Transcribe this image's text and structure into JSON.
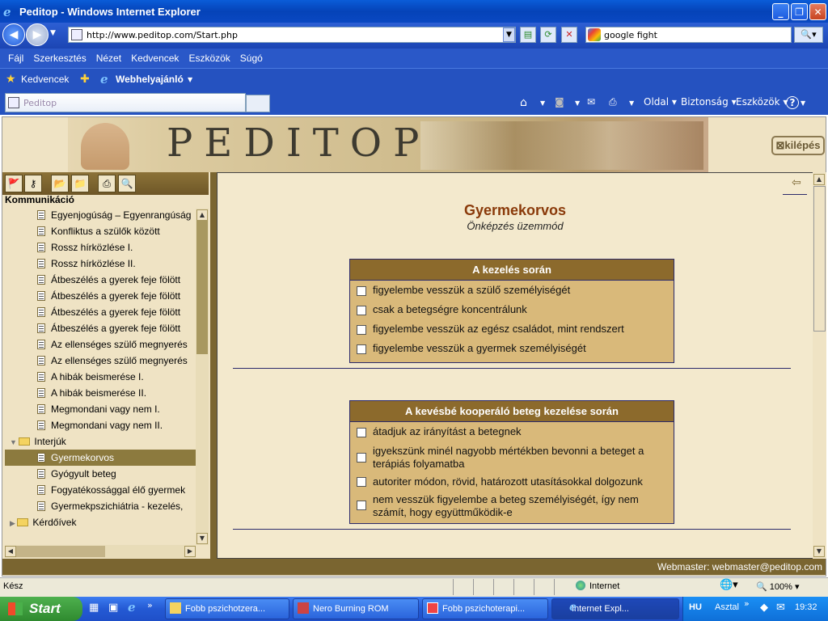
{
  "window": {
    "title": "Peditop - Windows Internet Explorer"
  },
  "address": {
    "url": "http://www.peditop.com/Start.php"
  },
  "search": {
    "value": "google fight"
  },
  "menu": [
    "Fájl",
    "Szerkesztés",
    "Nézet",
    "Kedvencek",
    "Eszközök",
    "Súgó"
  ],
  "favbar": {
    "favorites": "Kedvencek",
    "suggested": "Webhelyajánló"
  },
  "tab": {
    "title": "Peditop"
  },
  "commands": {
    "page": "Oldal",
    "security": "Biztonság",
    "tools": "Eszközök",
    "help": "?"
  },
  "site": {
    "logo": "PEDITOP",
    "logout": "kilépés"
  },
  "sidebar": {
    "title": "Kommunikáció",
    "items": [
      {
        "label": "Egyenjogúság – Egyenrangúság",
        "kind": "doc"
      },
      {
        "label": "Konfliktus a szülők között",
        "kind": "doc"
      },
      {
        "label": "Rossz hírközlése I.",
        "kind": "doc"
      },
      {
        "label": "Rossz hírközlése II.",
        "kind": "doc"
      },
      {
        "label": "Átbeszélés a gyerek feje fölött",
        "kind": "doc"
      },
      {
        "label": "Átbeszélés a gyerek feje fölött",
        "kind": "doc"
      },
      {
        "label": "Átbeszélés a gyerek feje fölött",
        "kind": "doc"
      },
      {
        "label": "Átbeszélés a gyerek feje fölött",
        "kind": "doc"
      },
      {
        "label": "Az ellenséges szülő megnyerés",
        "kind": "doc"
      },
      {
        "label": "Az ellenséges szülő megnyerés",
        "kind": "doc"
      },
      {
        "label": "A hibák beismerése I.",
        "kind": "doc"
      },
      {
        "label": "A hibák beismerése II.",
        "kind": "doc"
      },
      {
        "label": "Megmondani vagy nem I.",
        "kind": "doc"
      },
      {
        "label": "Megmondani vagy nem II.",
        "kind": "doc"
      },
      {
        "label": "Interjúk",
        "kind": "folder-open"
      },
      {
        "label": "Gyermekorvos",
        "kind": "doc",
        "selected": true
      },
      {
        "label": "Gyógyult beteg",
        "kind": "doc"
      },
      {
        "label": "Fogyatékossággal élő gyermek",
        "kind": "doc"
      },
      {
        "label": "Gyermekpszichiátria - kezelés,",
        "kind": "doc"
      },
      {
        "label": "Kérdőívek",
        "kind": "folder"
      }
    ]
  },
  "content": {
    "title": "Gyermekorvos",
    "subtitle": "Önképzés üzemmód",
    "q1": {
      "header": "A kezelés során",
      "options": [
        "figyelembe vesszük a szülő személyiségét",
        "csak a betegségre koncentrálunk",
        "figyelembe vesszük az egész családot, mint rendszert",
        "figyelembe vesszük a gyermek személyiségét"
      ]
    },
    "q2": {
      "header": "A kevésbé kooperáló beteg kezelése során",
      "options": [
        "átadjuk az irányítást a betegnek",
        "igyekszünk minél nagyobb mértékben bevonni a beteget a terápiás folyamatba",
        "autoriter módon, rövid, határozott utasításokkal dolgozunk",
        "nem vesszük figyelembe a beteg személyiségét, így nem számít, hogy együttműködik-e"
      ]
    },
    "footer": "Webmaster: webmaster@peditop.com"
  },
  "status": {
    "text": "Kész",
    "zone": "Internet",
    "zoom": "100%"
  },
  "taskbar": {
    "start": "Start",
    "tasks": [
      "Fobb pszichotzera...",
      "Nero Burning ROM",
      "Fobb pszichoterapi...",
      "Internet Expl..."
    ],
    "lang": "HU",
    "desktop": "Asztal",
    "clock": "19:32"
  }
}
